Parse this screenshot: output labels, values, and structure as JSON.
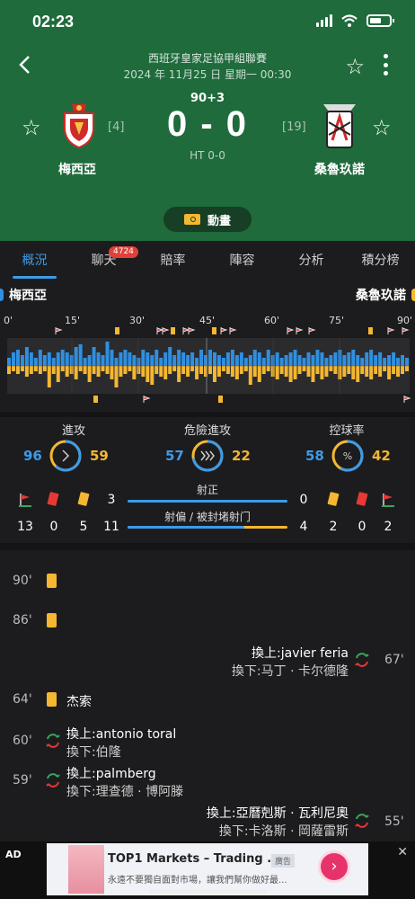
{
  "status": {
    "time": "02:23"
  },
  "match": {
    "league": "西班牙皇家足協甲組聯賽",
    "date": "2024 年 11月25 日 星期一 00:30",
    "minute": "90+3",
    "score": "0 - 0",
    "ht": "HT 0-0",
    "home": {
      "name": "梅西亞",
      "rank": "[4]"
    },
    "away": {
      "name": "桑魯玖諾",
      "rank": "[19]"
    },
    "animation_label": "動畫"
  },
  "tabs": [
    {
      "label": "概況"
    },
    {
      "label": "聊天",
      "badge": "4724"
    },
    {
      "label": "賠率"
    },
    {
      "label": "陣容"
    },
    {
      "label": "分析"
    },
    {
      "label": "積分榜"
    }
  ],
  "momentum": {
    "home": "梅西亞",
    "away": "桑魯玖諾",
    "ticks": [
      "0'",
      "15'",
      "30'",
      "45'",
      "60'",
      "75'",
      "90'"
    ],
    "colors": {
      "home": "#2f8fe0",
      "away": "#f5b731"
    },
    "home_values": [
      0.3,
      0.5,
      0.6,
      0.4,
      0.7,
      0.5,
      0.3,
      0.6,
      0.4,
      0.5,
      0.3,
      0.5,
      0.6,
      0.5,
      0.4,
      0.7,
      0.8,
      0.3,
      0.4,
      0.7,
      0.5,
      0.4,
      0.9,
      0.6,
      0.3,
      0.5,
      0.6,
      0.5,
      0.4,
      0.3,
      0.6,
      0.5,
      0.4,
      0.6,
      0.3,
      0.5,
      0.7,
      0.4,
      0.6,
      0.5,
      0.4,
      0.5,
      0.3,
      0.6,
      0.4,
      0.6,
      0.5,
      0.4,
      0.3,
      0.5,
      0.6,
      0.4,
      0.5,
      0.3,
      0.4,
      0.6,
      0.5,
      0.3,
      0.6,
      0.4,
      0.5,
      0.3,
      0.4,
      0.5,
      0.6,
      0.4,
      0.3,
      0.5,
      0.4,
      0.6,
      0.5,
      0.3,
      0.4,
      0.5,
      0.6,
      0.4,
      0.5,
      0.6,
      0.4,
      0.3,
      0.5,
      0.6,
      0.4,
      0.5,
      0.3,
      0.4,
      0.5,
      0.3,
      0.4,
      0.3
    ],
    "away_values": [
      0.3,
      0.2,
      0.3,
      0.2,
      0.4,
      0.3,
      0.2,
      0.3,
      0.2,
      0.8,
      0.3,
      0.6,
      0.2,
      0.4,
      0.3,
      0.5,
      0.2,
      0.3,
      0.6,
      0.3,
      0.4,
      0.2,
      0.3,
      0.5,
      0.8,
      0.4,
      0.3,
      0.2,
      0.5,
      0.3,
      0.4,
      0.6,
      0.7,
      0.3,
      0.4,
      0.5,
      0.3,
      0.2,
      0.6,
      0.3,
      0.4,
      0.2,
      0.5,
      0.3,
      0.4,
      0.3,
      0.6,
      0.4,
      0.2,
      0.3,
      0.4,
      0.5,
      0.3,
      0.2,
      0.7,
      0.4,
      0.6,
      0.3,
      0.2,
      0.4,
      0.5,
      0.3,
      0.4,
      0.6,
      0.5,
      0.3,
      0.2,
      0.4,
      0.6,
      0.3,
      0.5,
      0.4,
      0.2,
      0.3,
      0.5,
      0.4,
      0.3,
      0.5,
      0.6,
      0.3,
      0.4,
      0.5,
      0.3,
      0.4,
      0.2,
      0.5,
      0.3,
      0.4,
      0.3,
      0.2
    ]
  },
  "stats": {
    "attack": {
      "label": "進攻",
      "home": "96",
      "away": "59",
      "home_share": 0.62
    },
    "danger": {
      "label": "危險進攻",
      "home": "57",
      "away": "22",
      "home_share": 0.72
    },
    "possession": {
      "label": "控球率",
      "home": "58",
      "away": "42",
      "home_share": 0.58,
      "symbol": "%"
    },
    "home_counts": {
      "corners": "13",
      "red": "0",
      "yellow": "5",
      "shots_off": "11",
      "shots_on": "3"
    },
    "away_counts": {
      "corners": "2",
      "red": "0",
      "yellow": "2",
      "shots_off": "4",
      "shots_on": "0"
    },
    "shots_on_label": "射正",
    "shots_off_label": "射偏 / 被封堵射门",
    "shots_on_home_share": 1.0,
    "shots_off_home_share": 0.73
  },
  "events": [
    {
      "minute": "90'"
    },
    {
      "minute": "86'"
    },
    {
      "minute": "67'",
      "in": "換上:javier feria",
      "out": "換下:马丁 · 卡尔德隆"
    },
    {
      "minute": "64'",
      "player": "杰索"
    },
    {
      "minute": "60'",
      "in": "換上:antonio toral",
      "out": "換下:伯隆"
    },
    {
      "minute": "59'",
      "in": "換上:palmberg",
      "out": "換下:理查德 · 博阿滕"
    },
    {
      "minute": "55'",
      "in": "換上:亞曆剋斯 · 瓦利尼奧",
      "out": "換下:卡洛斯 · 岡薩雷斯"
    }
  ],
  "ad": {
    "label": "AD",
    "title": "TOP1 Markets – Trading ...",
    "tag": "廣告",
    "desc": "永遠不要獨自面對市場，讓我們幫你做好最..."
  }
}
